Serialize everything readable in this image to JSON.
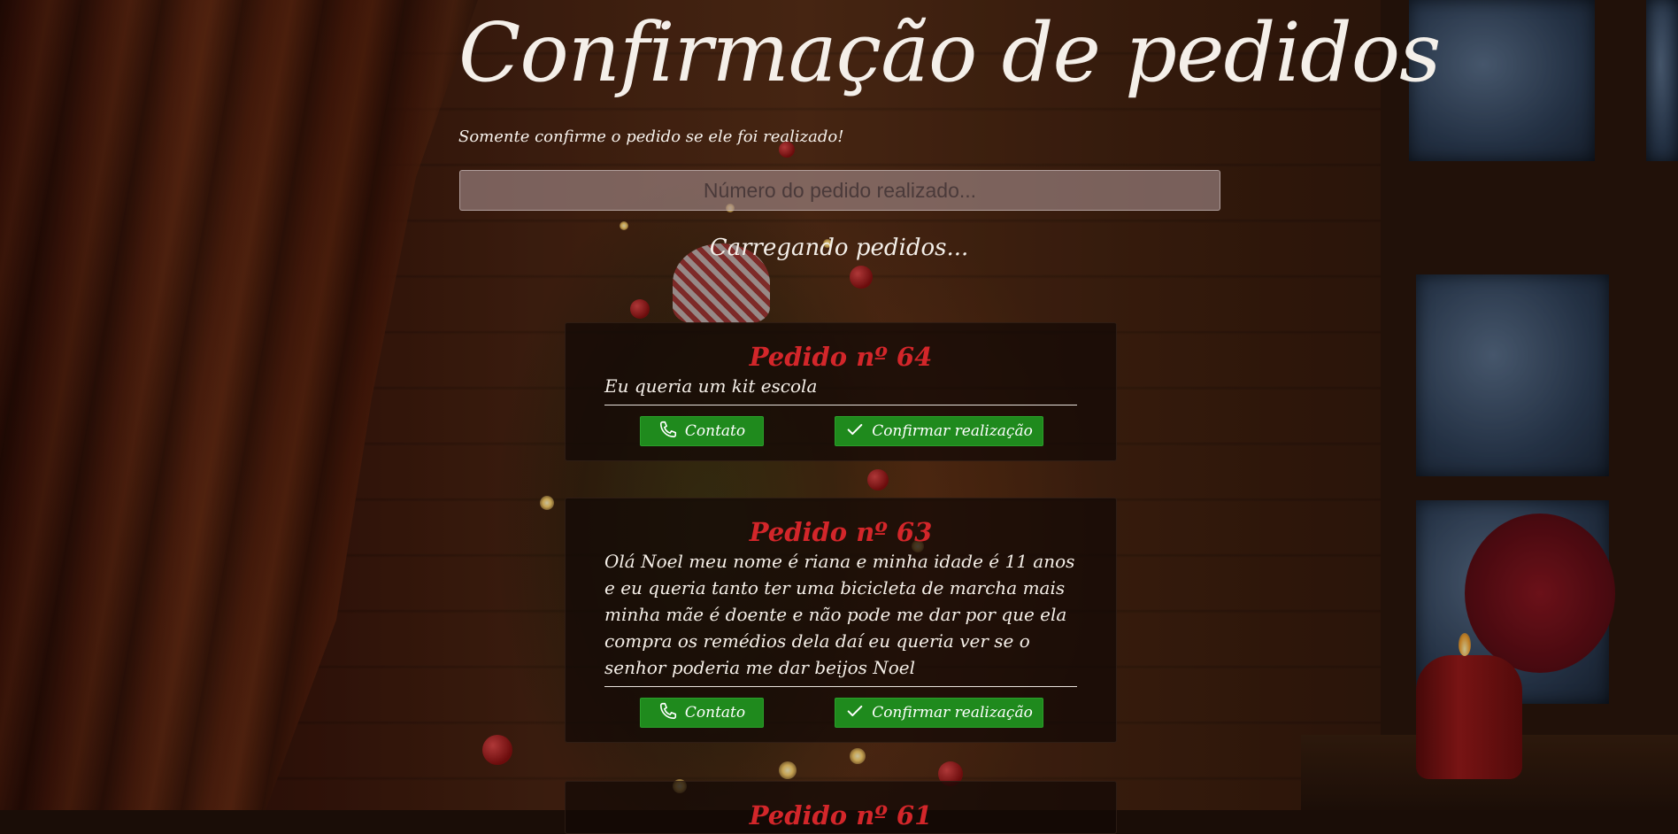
{
  "header": {
    "title": "Confirmação de pedidos",
    "subtitle": "Somente confirme o pedido se ele foi realizado!"
  },
  "search": {
    "placeholder": "Número do pedido realizado..."
  },
  "status": {
    "loading_text": "Carregando pedidos..."
  },
  "orders": [
    {
      "title": "Pedido nº 64",
      "text": "Eu queria um kit escola",
      "contact_label": "Contato",
      "confirm_label": "Confirmar realização"
    },
    {
      "title": "Pedido nº 63",
      "text": "Olá Noel meu nome é riana e minha idade é 11 anos e eu queria tanto ter uma bicicleta de marcha mais minha mãe é doente e não pode me dar por que ela compra os remédios dela daí eu queria ver se o senhor poderia me dar beijos Noel",
      "contact_label": "Contato",
      "confirm_label": "Confirmar realização"
    },
    {
      "title": "Pedido nº 61"
    }
  ],
  "icons": {
    "contact": "phone-icon",
    "confirm": "checkmark-icon"
  },
  "colors": {
    "order_title": "#d3262a",
    "button_green": "#1f8a1d",
    "text_light": "#f4efe9"
  }
}
